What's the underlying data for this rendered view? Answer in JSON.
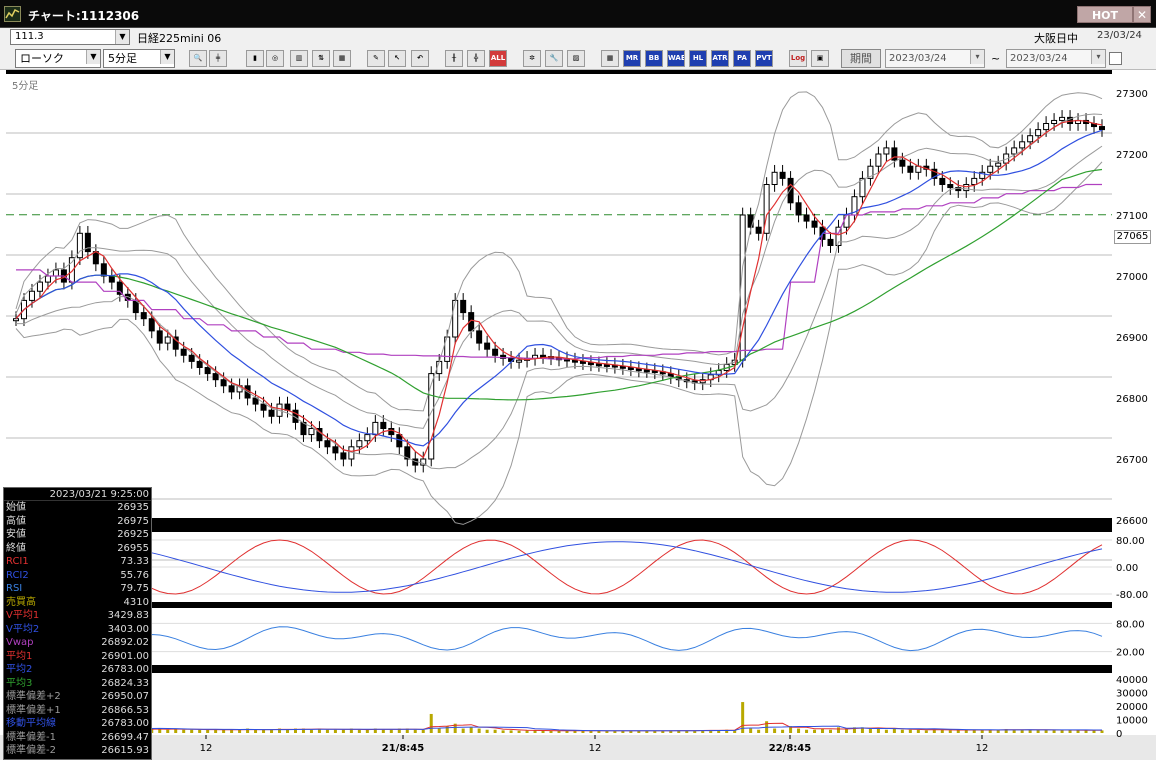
{
  "window": {
    "title": "チャート:1112306",
    "hot_label": "HOT",
    "close_label": "✕"
  },
  "toolbar": {
    "symbol": "111.3",
    "instrument_name": "日経225mini 06",
    "market": "大阪日中",
    "market_date": "23/03/24",
    "chart_type": "ローソク",
    "timeframe": "5分足",
    "period_label": "期間",
    "date_from": "2023/03/24",
    "date_to": "2023/03/24",
    "date_sep": "~",
    "buttons": [
      "MR",
      "BB",
      "WAE",
      "HL",
      "ATR",
      "PA",
      "PVT",
      "Log",
      "ALL"
    ]
  },
  "chart": {
    "timeframe_label": "5分足",
    "current_price": "27065",
    "price_axis": [
      "27300",
      "27200",
      "27100",
      "27000",
      "26900",
      "26800",
      "26700",
      "26600"
    ],
    "rci_axis": [
      "80.00",
      "0.00",
      "-80.00"
    ],
    "rsi_axis": [
      "80.00",
      "20.00"
    ],
    "volume_axis": [
      "40000",
      "30000",
      "20000",
      "10000",
      "0"
    ],
    "time_labels": [
      "12",
      "21/8:45",
      "12",
      "22/8:45",
      "12"
    ]
  },
  "info_panel": {
    "datetime": "2023/03/21 9:25:00",
    "rows": [
      {
        "label": "始値",
        "value": "26935",
        "color": "#dddddd"
      },
      {
        "label": "高値",
        "value": "26975",
        "color": "#dddddd"
      },
      {
        "label": "安値",
        "value": "26925",
        "color": "#dddddd"
      },
      {
        "label": "終値",
        "value": "26955",
        "color": "#dddddd"
      },
      {
        "label": "RCI1",
        "value": "73.33",
        "color": "#e03030"
      },
      {
        "label": "RCI2",
        "value": "55.76",
        "color": "#3050e0"
      },
      {
        "label": "RSI",
        "value": "79.75",
        "color": "#3a80e0"
      },
      {
        "label": "売買高",
        "value": "4310",
        "color": "#b8a800"
      },
      {
        "label": "V平均1",
        "value": "3429.83",
        "color": "#e03030"
      },
      {
        "label": "V平均2",
        "value": "3403.00",
        "color": "#3050e0"
      },
      {
        "label": "Vwap",
        "value": "26892.02",
        "color": "#b040c0"
      },
      {
        "label": "平均1",
        "value": "26901.00",
        "color": "#e03030"
      },
      {
        "label": "平均2",
        "value": "26783.00",
        "color": "#3050e0"
      },
      {
        "label": "平均3",
        "value": "26824.33",
        "color": "#30a030"
      },
      {
        "label": "標準偏差+2",
        "value": "26950.07",
        "color": "#9a9a9a"
      },
      {
        "label": "標準偏差+1",
        "value": "26866.53",
        "color": "#9a9a9a"
      },
      {
        "label": "移動平均線",
        "value": "26783.00",
        "color": "#3050e0"
      },
      {
        "label": "標準偏差-1",
        "value": "26699.47",
        "color": "#9a9a9a"
      },
      {
        "label": "標準偏差-2",
        "value": "26615.93",
        "color": "#9a9a9a"
      }
    ]
  },
  "chart_data": {
    "type": "line",
    "panels": [
      "candlestick",
      "rci",
      "rsi",
      "volume"
    ],
    "price_range": [
      26560,
      27330
    ],
    "close_series": [
      26930,
      26960,
      26975,
      26990,
      27000,
      27010,
      26990,
      27030,
      27070,
      27040,
      27020,
      27000,
      26990,
      26970,
      26960,
      26940,
      26930,
      26910,
      26890,
      26900,
      26880,
      26870,
      26860,
      26850,
      26840,
      26830,
      26820,
      26810,
      26820,
      26800,
      26790,
      26780,
      26770,
      26790,
      26780,
      26760,
      26740,
      26750,
      26730,
      26720,
      26710,
      26700,
      26720,
      26730,
      26740,
      26760,
      26750,
      26740,
      26720,
      26700,
      26690,
      26700,
      26840,
      26860,
      26900,
      26960,
      26940,
      26910,
      26890,
      26880,
      26870,
      26865,
      26860,
      26862,
      26865,
      26870,
      26868,
      26866,
      26864,
      26862,
      26860,
      26858,
      26856,
      26855,
      26854,
      26852,
      26850,
      26848,
      26846,
      26845,
      26843,
      26840,
      26835,
      26830,
      26828,
      26825,
      26830,
      26838,
      26845,
      26855,
      26862,
      27100,
      27080,
      27070,
      27150,
      27170,
      27160,
      27120,
      27100,
      27090,
      27080,
      27060,
      27050,
      27080,
      27100,
      27130,
      27160,
      27180,
      27200,
      27210,
      27190,
      27180,
      27170,
      27180,
      27175,
      27160,
      27150,
      27145,
      27140,
      27150,
      27160,
      27170,
      27180,
      27185,
      27200,
      27210,
      27220,
      27230,
      27240,
      27250,
      27255,
      27260,
      27250,
      27255,
      27250,
      27245,
      27240
    ],
    "vwap": [
      27010,
      27000,
      26990,
      26975,
      26960,
      26945,
      26930,
      26920,
      26910,
      26900,
      26890,
      26880,
      26875,
      26872,
      26870,
      26869,
      26868,
      26867,
      26866,
      26865,
      26864,
      26866,
      26868,
      26870,
      26872,
      26874,
      26876,
      26878,
      26880,
      26990,
      27070,
      27100,
      27105,
      27110,
      27115,
      27120,
      27128,
      27135,
      27140,
      27145,
      27150
    ],
    "ma1_color": "#e03030",
    "ma2_color": "#3050e0",
    "ma3_color": "#30a030",
    "vwap_color": "#b040c0",
    "band_color": "#9a9a9a",
    "dashed_level": 27120,
    "volume_scale": [
      0,
      40000
    ]
  }
}
